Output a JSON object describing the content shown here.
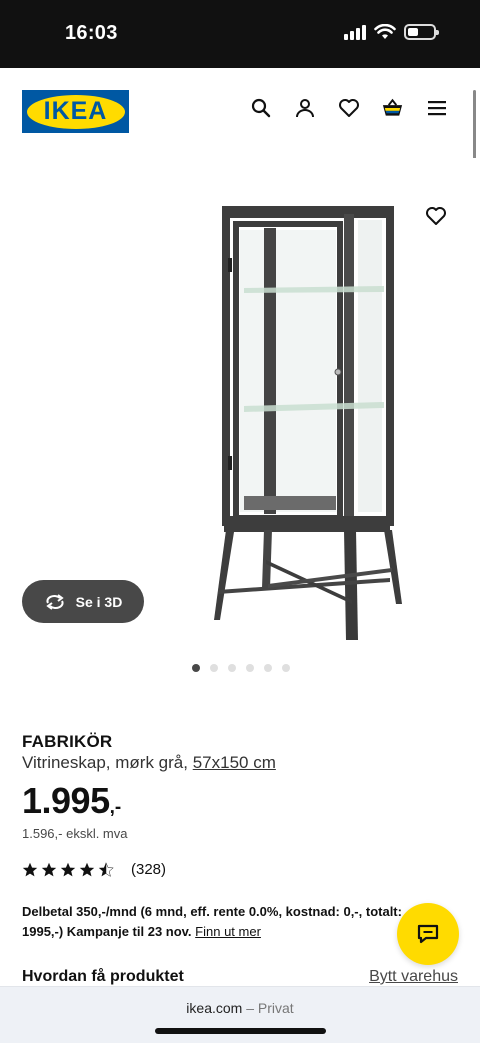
{
  "status_bar": {
    "time": "16:03"
  },
  "header": {
    "logo_text": "IKEA",
    "icons": [
      "search-icon",
      "user-icon",
      "heart-icon",
      "cart-icon",
      "menu-icon"
    ]
  },
  "gallery": {
    "view_3d_label": "Se i 3D",
    "slide_count": 6,
    "active_slide": 1
  },
  "product": {
    "name": "FABRIKÖR",
    "description": "Vitrineskap, mørk grå,",
    "size": "57x150 cm",
    "price": "1.995",
    "price_suffix": ",-",
    "price_excl_vat": "1.596,- ekskl. mva",
    "rating_value": 4.5,
    "rating_count": "(328)"
  },
  "financing": {
    "line1": "Delbetal 350,-/mnd (6 mnd, eff. rente 0.0%, kostnad: 0,-, totalt:",
    "line2": "1995,-) Kampanje til 23 nov.",
    "link": "Finn ut mer"
  },
  "delivery": {
    "title": "Hvordan få produktet",
    "change_store": "Bytt varehus"
  },
  "browser": {
    "domain": "ikea.com",
    "separator": "–",
    "mode": "Privat"
  },
  "colors": {
    "ikea_blue": "#0058a3",
    "ikea_yellow": "#ffdb00",
    "dark_grey": "#484848"
  }
}
